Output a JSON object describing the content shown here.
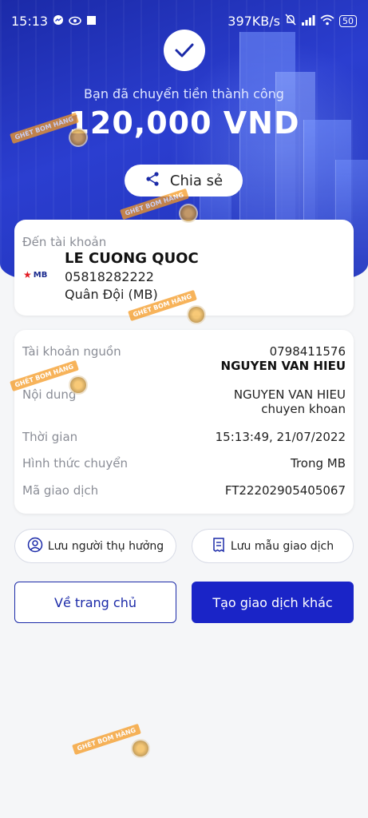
{
  "status_bar": {
    "time": "15:13",
    "network_speed": "397KB/s",
    "battery": "50"
  },
  "header": {
    "success_message": "Bạn đã chuyển tiền thành công",
    "amount": "120,000 VND",
    "share_label": "Chia sẻ"
  },
  "destination": {
    "label": "Đến tài khoản",
    "bank_logo_text": "MB",
    "name": "LE CUONG QUOC",
    "account": "05818282222",
    "bank": "Quân Đội (MB)"
  },
  "details": {
    "source_label": "Tài khoản nguồn",
    "source_account": "0798411576",
    "source_name": "NGUYEN VAN HIEU",
    "content_label": "Nội dung",
    "content_line1": "NGUYEN VAN HIEU",
    "content_line2": "chuyen khoan",
    "time_label": "Thời gian",
    "time_value": "15:13:49, 21/07/2022",
    "method_label": "Hình thức chuyển",
    "method_value": "Trong MB",
    "txn_label": "Mã giao dịch",
    "txn_value": "FT22202905405067"
  },
  "actions": {
    "save_recipient": "Lưu người thụ hưởng",
    "save_template": "Lưu mẫu giao dịch",
    "home": "Về trang chủ",
    "new_transaction": "Tạo giao dịch khác"
  },
  "watermark": {
    "text": "GHÉT BOM HÀNG"
  },
  "colors": {
    "hero_blue": "#1b2aa8",
    "primary_button": "#1a24c7",
    "watermark_orange": "#f59a23"
  }
}
